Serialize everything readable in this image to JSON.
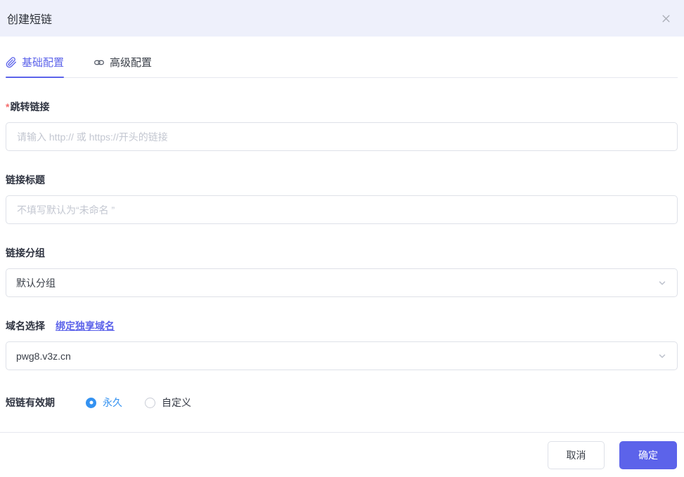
{
  "dialog": {
    "title": "创建短链"
  },
  "tabs": [
    {
      "label": "基础配置",
      "icon": "paperclip-icon",
      "active": true
    },
    {
      "label": "高级配置",
      "icon": "chain-link-icon",
      "active": false
    }
  ],
  "form": {
    "jump_link": {
      "label": "跳转链接",
      "required_mark": "*",
      "placeholder": "请输入 http:// 或 https://开头的链接",
      "value": ""
    },
    "link_title": {
      "label": "链接标题",
      "placeholder": "不填写默认为“未命名 ”",
      "value": ""
    },
    "link_group": {
      "label": "链接分组",
      "selected_value": "默认分组"
    },
    "domain": {
      "label": "域名选择",
      "bind_link_label": "绑定独享域名",
      "selected_value": "pwg8.v3z.cn"
    },
    "expiry": {
      "label": "短链有效期",
      "options": [
        {
          "label": "永久",
          "selected": true
        },
        {
          "label": "自定义",
          "selected": false
        }
      ]
    }
  },
  "footer": {
    "cancel_label": "取消",
    "confirm_label": "确定"
  },
  "colors": {
    "accent_purple": "#5c63ea",
    "radio_blue": "#3492f1",
    "required_red": "#f56c6c",
    "header_bg": "#eef0fb",
    "border_gray": "#dee1e8",
    "placeholder_gray": "#c3c7d1"
  }
}
